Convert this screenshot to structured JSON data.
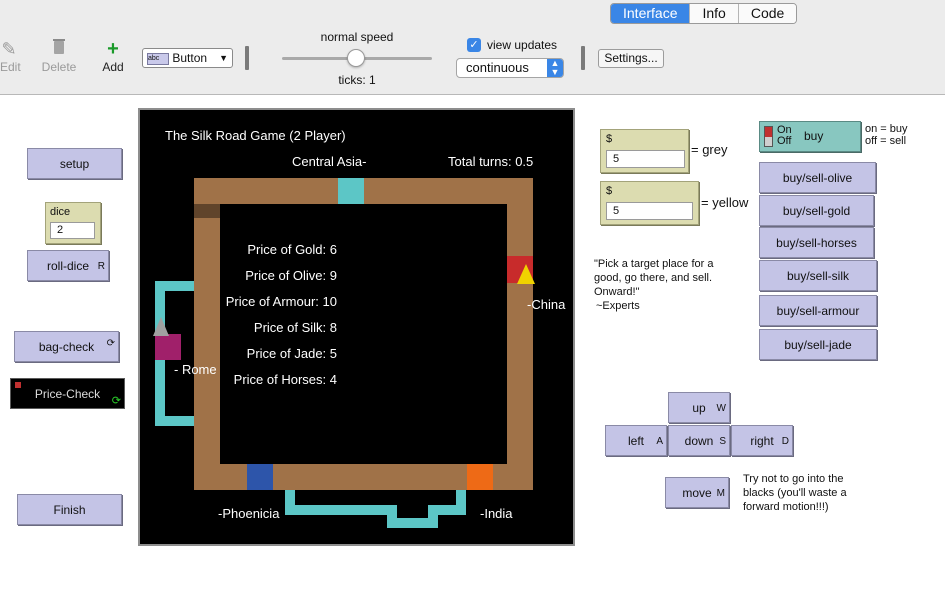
{
  "tabs": [
    "Interface",
    "Info",
    "Code"
  ],
  "toolbar": {
    "edit_label": "Edit",
    "delete_label": "Delete",
    "add_label": "Add",
    "widget_type": "Button",
    "speed_label": "normal speed",
    "ticks_label": "ticks: 1",
    "view_updates_label": "view updates",
    "update_mode": "continuous",
    "settings_label": "Settings..."
  },
  "buttons": {
    "setup": "setup",
    "roll_dice": "roll-dice",
    "roll_dice_key": "R",
    "bag_check": "bag-check",
    "price_check": "Price-Check",
    "finish": "Finish",
    "buy_olive": "buy/sell-olive",
    "buy_gold": "buy/sell-gold",
    "buy_horses": "buy/sell-horses",
    "buy_silk": "buy/sell-silk",
    "buy_armour": "buy/sell-armour",
    "buy_jade": "buy/sell-jade",
    "up": "up",
    "up_key": "W",
    "left": "left",
    "left_key": "A",
    "down": "down",
    "down_key": "S",
    "right": "right",
    "right_key": "D",
    "move": "move",
    "move_key": "M"
  },
  "dice": {
    "label": "dice",
    "value": "2"
  },
  "money": [
    {
      "label": "$",
      "value": "5",
      "owner": "= grey"
    },
    {
      "label": "$",
      "value": "5",
      "owner": "= yellow"
    }
  ],
  "switch": {
    "on": "On",
    "off": "Off",
    "label": "buy",
    "note_on": "on = buy",
    "note_off": "off = sell"
  },
  "notes": {
    "experts_quote": "\"Pick a target place for a good, go there, and sell. Onward!\"",
    "experts_attrib": "~Experts",
    "warning": "Try not to go into the blacks (you'll waste a forward motion!!!)"
  },
  "view": {
    "title": "The Silk Road Game (2 Player)",
    "total_turns": "Total turns: 0.5",
    "places": {
      "central_asia": "Central Asia-",
      "china": "-China",
      "rome": "- Rome",
      "phoenicia": "-Phoenicia",
      "india": "-India"
    },
    "prices": [
      "Price of Gold: 6",
      "Price of Olive: 9",
      "Price of Armour: 10",
      "Price of Silk: 8",
      "Price of Jade: 5",
      "Price of Horses: 4"
    ]
  },
  "colors": {
    "road": "#a07248",
    "route_teal": "#5cc6c6",
    "china_tile": "#c82b2b",
    "rome_tile": "#a0206a",
    "phoenicia_tile": "#2d55aa",
    "india_tile": "#ee6a16",
    "player_yellow": "#f0d200",
    "player_grey": "#a0a0a0",
    "button_fill": "#c4c4e6",
    "tab_active": "#3a86e6"
  }
}
